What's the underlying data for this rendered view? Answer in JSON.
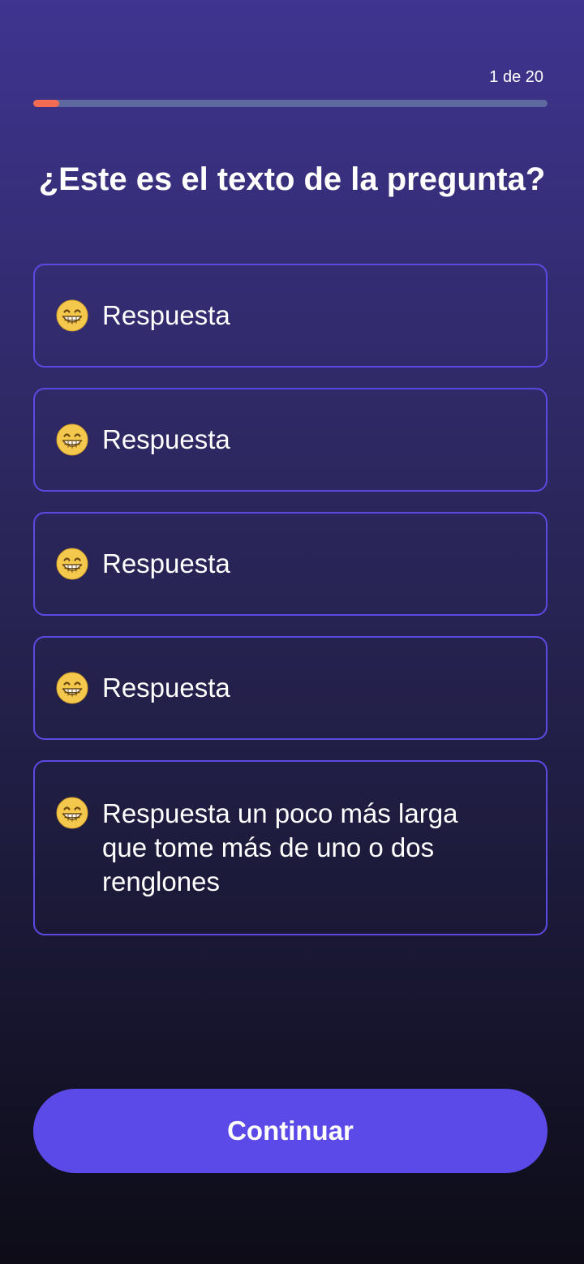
{
  "header": {
    "counter": "1 de 20",
    "progress_fraction": 0.05,
    "progress_color": "#f26b52",
    "track_color": "#5e6a9f"
  },
  "question": {
    "text": "¿Este es el texto de la pregunta?"
  },
  "answers": [
    {
      "icon": "grinning-face-emoji-icon",
      "label": "Respuesta"
    },
    {
      "icon": "grinning-face-emoji-icon",
      "label": "Respuesta"
    },
    {
      "icon": "grinning-face-emoji-icon",
      "label": "Respuesta"
    },
    {
      "icon": "grinning-face-emoji-icon",
      "label": "Respuesta"
    },
    {
      "icon": "grinning-face-emoji-icon",
      "label": "Respuesta un poco más larga que tome más de uno o dos renglones"
    }
  ],
  "footer": {
    "continue_label": "Continuar",
    "button_color": "#5b49e8"
  },
  "colors": {
    "accent": "#5b4ae1",
    "background_top": "#3f3490",
    "background_bottom": "#0d0c17"
  }
}
